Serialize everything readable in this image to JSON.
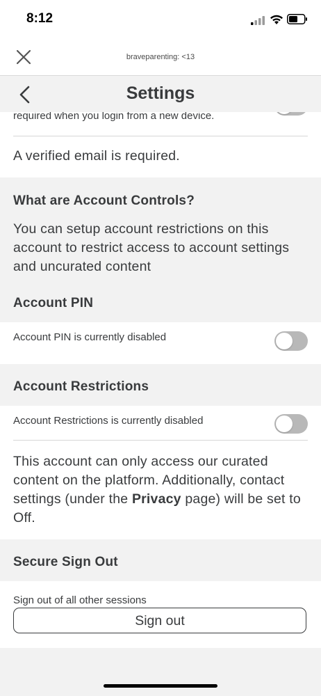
{
  "status_bar": {
    "time": "8:12"
  },
  "browser": {
    "url": "braveparenting: <13"
  },
  "header": {
    "title": "Settings"
  },
  "top": {
    "cut_text": "required when you login from a new device.",
    "verified_email": "A verified email is required."
  },
  "account_controls": {
    "heading": "What are Account Controls?",
    "description": "You can setup account restrictions on this account to restrict access to account settings and uncurated content"
  },
  "account_pin": {
    "heading": "Account PIN",
    "status": "Account PIN is currently disabled",
    "enabled": false
  },
  "account_restrictions": {
    "heading": "Account Restrictions",
    "status": "Account Restrictions is currently disabled",
    "enabled": false,
    "desc_part1": "This account can only access our curated content on the platform. Additionally, contact settings (under the ",
    "desc_link": "Privacy",
    "desc_part2": " page) will be set to Off."
  },
  "secure_sign_out": {
    "heading": "Secure Sign Out",
    "label": "Sign out of all other sessions",
    "button": "Sign out"
  }
}
